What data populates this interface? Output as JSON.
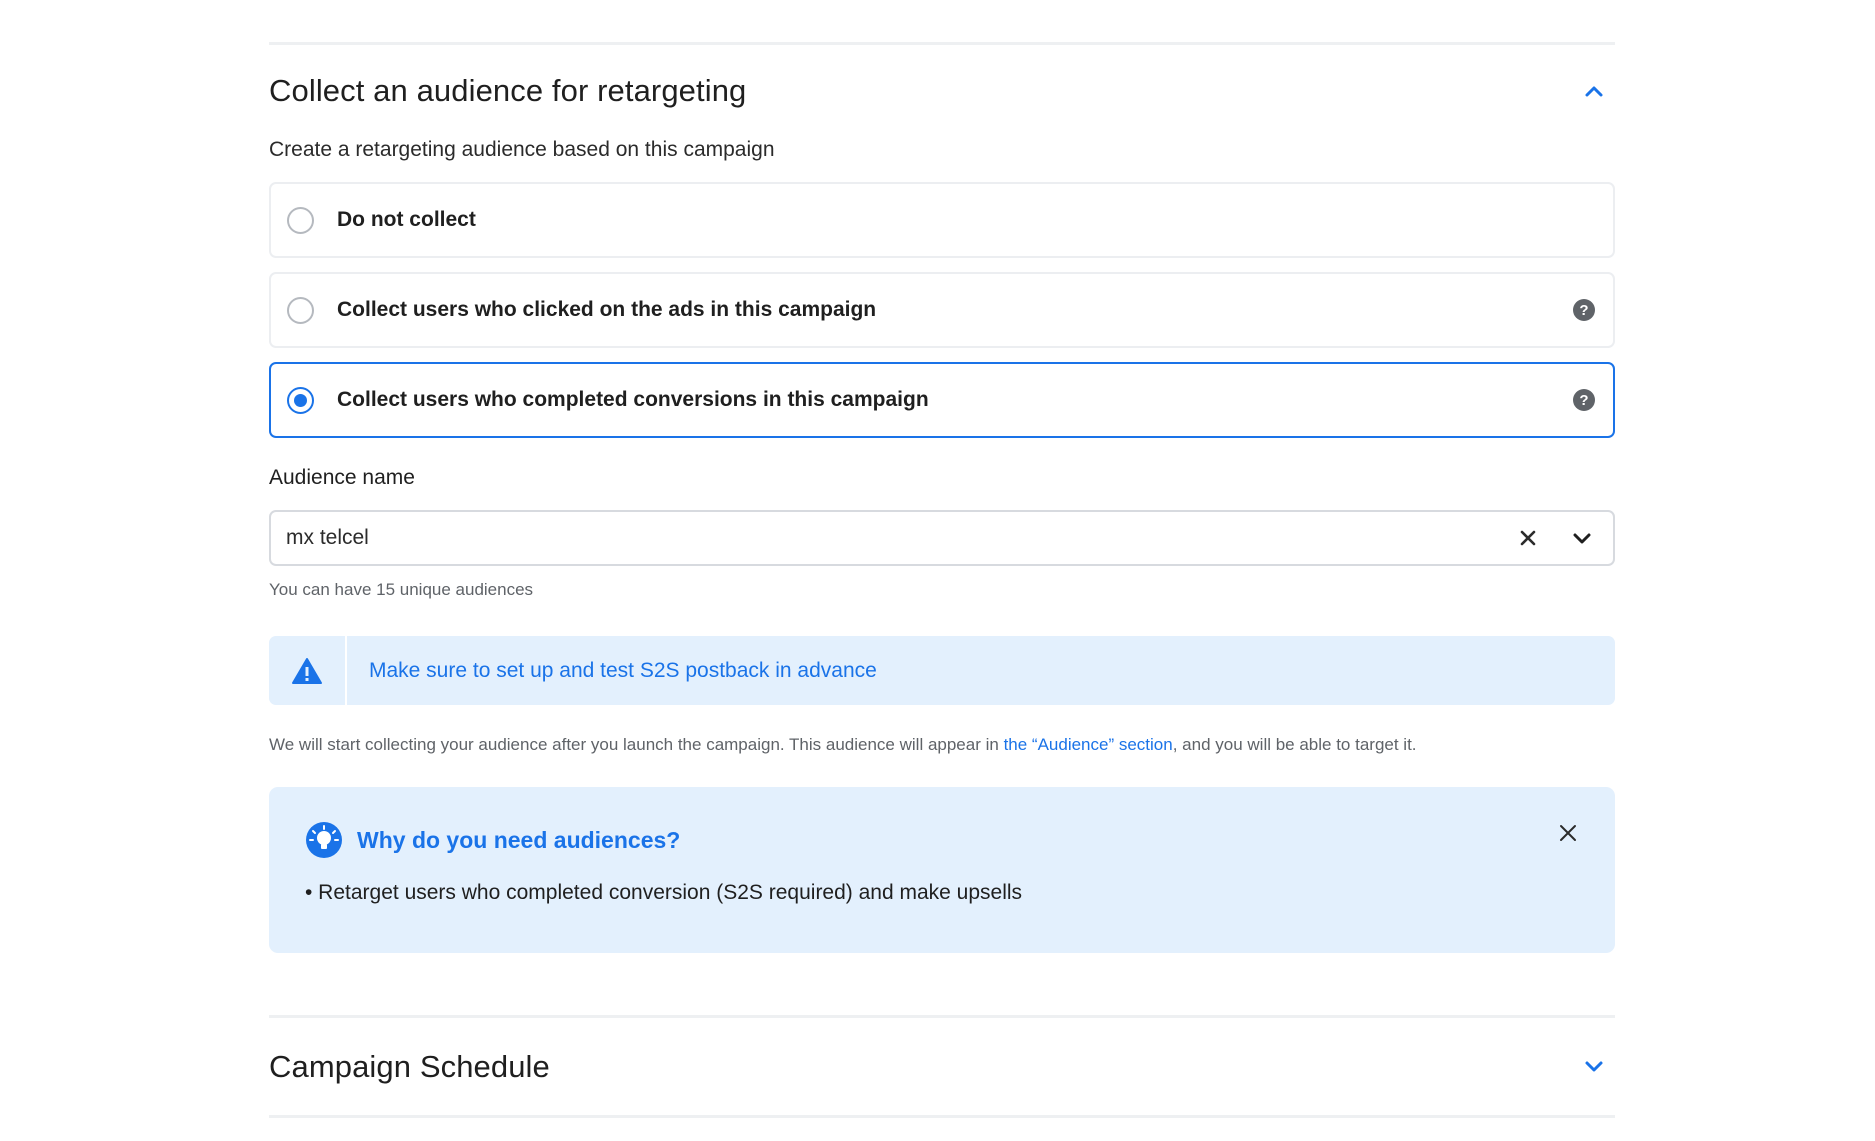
{
  "retargeting": {
    "title": "Collect an audience for retargeting",
    "subtitle": "Create a retargeting audience based on this campaign",
    "options": [
      {
        "label": "Do not collect",
        "selected": false,
        "help": false
      },
      {
        "label": "Collect users who clicked on the ads in this campaign",
        "selected": false,
        "help": true
      },
      {
        "label": "Collect users who completed conversions in this campaign",
        "selected": true,
        "help": true
      }
    ],
    "help_glyph": "?"
  },
  "audience_name": {
    "label": "Audience name",
    "value": "mx telcel",
    "hint": "You can have 15 unique audiences"
  },
  "warning": {
    "icon": "warning-triangle-icon",
    "text": "Make sure to set up and test S2S postback in advance"
  },
  "note": {
    "before": "We will start collecting your audience after you launch the campaign. This audience will appear in ",
    "link": "the “Audience” section",
    "after": ", and you will be able to target it."
  },
  "info": {
    "icon": "lightbulb-icon",
    "title": "Why do you need audiences?",
    "bullet": "• Retarget users who completed conversion (S2S required) and make upsells"
  },
  "schedule": {
    "title": "Campaign Schedule"
  },
  "colors": {
    "accent": "#1a73e8",
    "info_bg": "#e3f0fd",
    "border": "#eceef1"
  }
}
